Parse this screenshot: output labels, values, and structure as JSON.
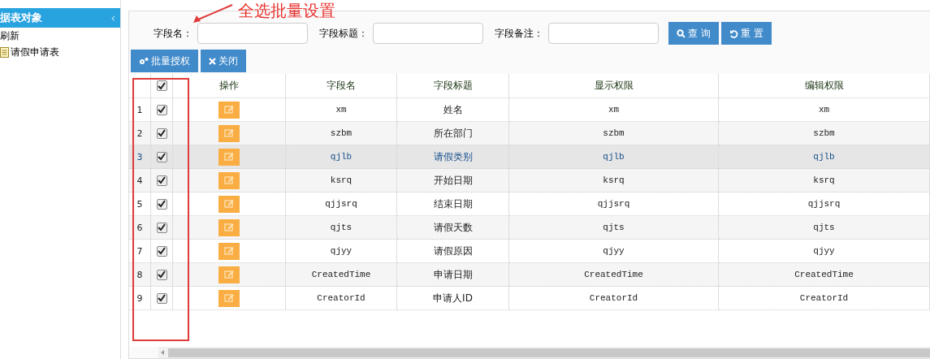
{
  "sidebar": {
    "title": "据表对象",
    "collapse_glyph": "‹",
    "items": [
      {
        "label": "刷新",
        "kind": "action"
      },
      {
        "label": "请假申请表",
        "kind": "document"
      }
    ]
  },
  "search": {
    "fields": [
      {
        "label": "字段名："
      },
      {
        "label": "字段标题："
      },
      {
        "label": "字段备注："
      }
    ],
    "buttons": [
      {
        "label": "查 询",
        "kind": "search"
      },
      {
        "label": "重 置",
        "kind": "reset"
      }
    ]
  },
  "toolbar": [
    {
      "label": "批量授权",
      "kind": "batch"
    },
    {
      "label": "关闭",
      "kind": "close"
    }
  ],
  "table": {
    "all_checked": true,
    "columns": [
      "操作",
      "字段名",
      "字段标题",
      "显示权限",
      "编辑权限"
    ],
    "rows": [
      {
        "index": "1",
        "checked": true,
        "selected": false,
        "field": "xm",
        "title": "姓名",
        "display": "xm",
        "edit": "xm"
      },
      {
        "index": "2",
        "checked": true,
        "selected": false,
        "field": "szbm",
        "title": "所在部门",
        "display": "szbm",
        "edit": "szbm"
      },
      {
        "index": "3",
        "checked": true,
        "selected": true,
        "field": "qjlb",
        "title": "请假类别",
        "display": "qjlb",
        "edit": "qjlb"
      },
      {
        "index": "4",
        "checked": true,
        "selected": false,
        "field": "ksrq",
        "title": "开始日期",
        "display": "ksrq",
        "edit": "ksrq"
      },
      {
        "index": "5",
        "checked": true,
        "selected": false,
        "field": "qjjsrq",
        "title": "结束日期",
        "display": "qjjsrq",
        "edit": "qjjsrq"
      },
      {
        "index": "6",
        "checked": true,
        "selected": false,
        "field": "qjts",
        "title": "请假天数",
        "display": "qjts",
        "edit": "qjts"
      },
      {
        "index": "7",
        "checked": true,
        "selected": false,
        "field": "qjyy",
        "title": "请假原因",
        "display": "qjyy",
        "edit": "qjyy"
      },
      {
        "index": "8",
        "checked": true,
        "selected": false,
        "field": "CreatedTime",
        "title": "申请日期",
        "display": "CreatedTime",
        "edit": "CreatedTime"
      },
      {
        "index": "9",
        "checked": true,
        "selected": false,
        "field": "CreatorId",
        "title": "申请人ID",
        "display": "CreatorId",
        "edit": "CreatorId"
      }
    ]
  },
  "annotation": {
    "text": "全选批量设置"
  }
}
